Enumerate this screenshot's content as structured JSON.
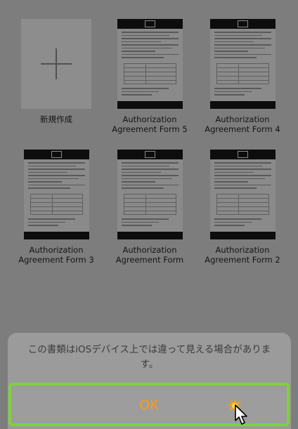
{
  "documents": {
    "new_label": "新規作成",
    "items": [
      {
        "line1": "Authorization",
        "line2": "Agreement Form 5"
      },
      {
        "line1": "Authorization",
        "line2": "Agreement Form 4"
      },
      {
        "line1": "Authorization",
        "line2": "Agreement Form 3"
      },
      {
        "line1": "Authorization",
        "line2": "Agreement Form"
      },
      {
        "line1": "Authorization",
        "line2": "Agreement Form 2"
      }
    ]
  },
  "alert": {
    "message": "この書類はiOSデバイス上では違って見える場合があります。",
    "ok_label": "OK"
  },
  "icons": {
    "new_document": "plus-icon",
    "cursor": "mouse-pointer-icon",
    "click": "click-burst-icon"
  },
  "colors": {
    "ok_text": "#ff9a14",
    "highlight": "#7fd13b",
    "document_header": "#0d0d0d"
  }
}
